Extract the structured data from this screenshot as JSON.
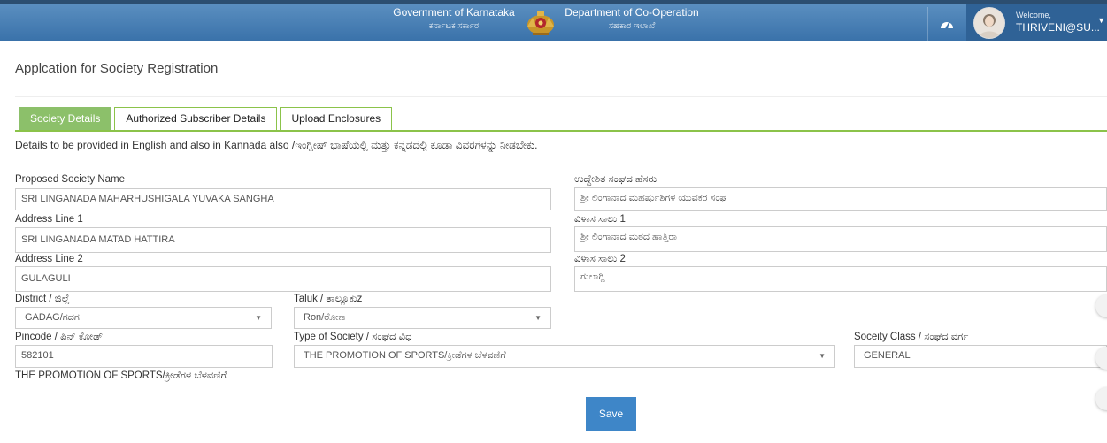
{
  "header": {
    "gov_en": "Government of Karnataka",
    "gov_kn": "ಕರ್ನಾಟಕ ಸರ್ಕಾರ",
    "dept_en": "Department of Co-Operation",
    "dept_kn": "ಸಹಕಾರ ಇಲಾಖೆ",
    "welcome": "Welcome,",
    "username": "THRIVENI@SU..."
  },
  "page": {
    "title": "Applcation for Society Registration",
    "tabs": [
      {
        "label": "Society Details",
        "active": true
      },
      {
        "label": "Authorized Subscriber Details",
        "active": false
      },
      {
        "label": "Upload Enclosures",
        "active": false
      }
    ],
    "instruction": "Details to be provided in English and also in Kannada also /ಇಂಗ್ಲೀಷ್ ಭಾಷೆಯಲ್ಲಿ ಮತ್ತು ಕನ್ನಡದಲ್ಲಿ ಕೂಡಾ ವಿವರಗಳನ್ನು ನೀಡಬೇಕು."
  },
  "form": {
    "society_name_label": "Proposed Society Name",
    "society_name_value": "SRI LINGANADA  MAHARHUSHIGALA YUVAKA SANGHA",
    "society_name_kn_label": "ಉದ್ದೇಶಿತ ಸಂಘದ ಹೆಸರು",
    "society_name_kn_value": "ಶ್ರೀ ಲಿಂಗಾನಾದ ಮಹರ್ಷುಶಿಗಳ ಯುವಕರ ಸಂಘ",
    "address1_label": "Address Line 1",
    "address1_value": "SRI LINGANADA  MATAD HATTIRA",
    "address1_kn_label": "ವಿಳಾಸ ಸಾಲು 1",
    "address1_kn_value": "ಶ್ರೀ ಲಿಂಗಾನಾದ ಮಠದ ಹಾತ್ತಿರಾ",
    "address2_label": "Address Line 2",
    "address2_value": "GULAGULI",
    "address2_kn_label": "ವಿಳಾಸ ಸಾಲು 2",
    "address2_kn_value": "ಗುಲಾಗ್ಲಿ",
    "district_label": "District / ಜಿಲ್ಲೆ",
    "district_value": "GADAG/ಗದಗ",
    "taluk_label": "Taluk / ತಾಲ್ಲೂಕುz",
    "taluk_value": "Ron/ರೋಣ",
    "pincode_label": "Pincode / ಪಿನ್ ಕೋಡ್",
    "pincode_value": "582101",
    "type_label": "Type of Society / ಸಂಘದ ವಿಧ",
    "type_value": "THE PROMOTION OF SPORTS/ಕ್ರೀಡೆಗಳ ಬೆಳವಣಿಗೆ",
    "class_label": "Soceity Class / ಸಂಘದ ವರ್ಗ",
    "class_value": "GENERAL",
    "type_note": "THE PROMOTION OF SPORTS/ಕ್ರೀಡೆಗಳ ಬೆಳವಣಿಗೆ",
    "save_label": "Save"
  },
  "icons": {
    "dashboard": "speedometer-icon",
    "emblem": "karnataka-emblem",
    "dropdown": "triangle-down-icon"
  },
  "colors": {
    "header_blue": "#3a72aa",
    "tab_green": "#8cc06a",
    "save_blue": "#3e86c8"
  }
}
